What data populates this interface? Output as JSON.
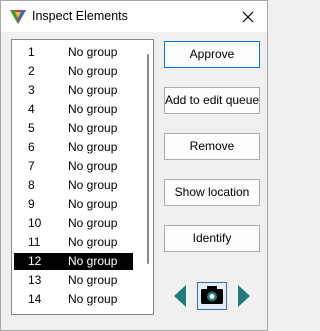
{
  "window": {
    "title": "Inspect Elements"
  },
  "list": {
    "rows": [
      {
        "num": "1",
        "group": "No group"
      },
      {
        "num": "2",
        "group": "No group"
      },
      {
        "num": "3",
        "group": "No group"
      },
      {
        "num": "4",
        "group": "No group"
      },
      {
        "num": "5",
        "group": "No group"
      },
      {
        "num": "6",
        "group": "No group"
      },
      {
        "num": "7",
        "group": "No group"
      },
      {
        "num": "8",
        "group": "No group"
      },
      {
        "num": "9",
        "group": "No group"
      },
      {
        "num": "10",
        "group": "No group"
      },
      {
        "num": "11",
        "group": "No group"
      },
      {
        "num": "12",
        "group": "No group"
      },
      {
        "num": "13",
        "group": "No group"
      },
      {
        "num": "14",
        "group": "No group"
      }
    ],
    "selected_index": 11
  },
  "buttons": {
    "approve": "Approve",
    "add_to_queue": "Add to edit queue",
    "remove": "Remove",
    "show_location": "Show location",
    "identify": "Identify"
  },
  "navigation": {
    "prev_icon": "triangle-left-icon",
    "camera_icon": "camera-icon",
    "next_icon": "triangle-right-icon"
  },
  "colors": {
    "selection_bg": "#000000",
    "focus_border": "#0078d7",
    "arrow_teal": "#1e7b7b"
  }
}
